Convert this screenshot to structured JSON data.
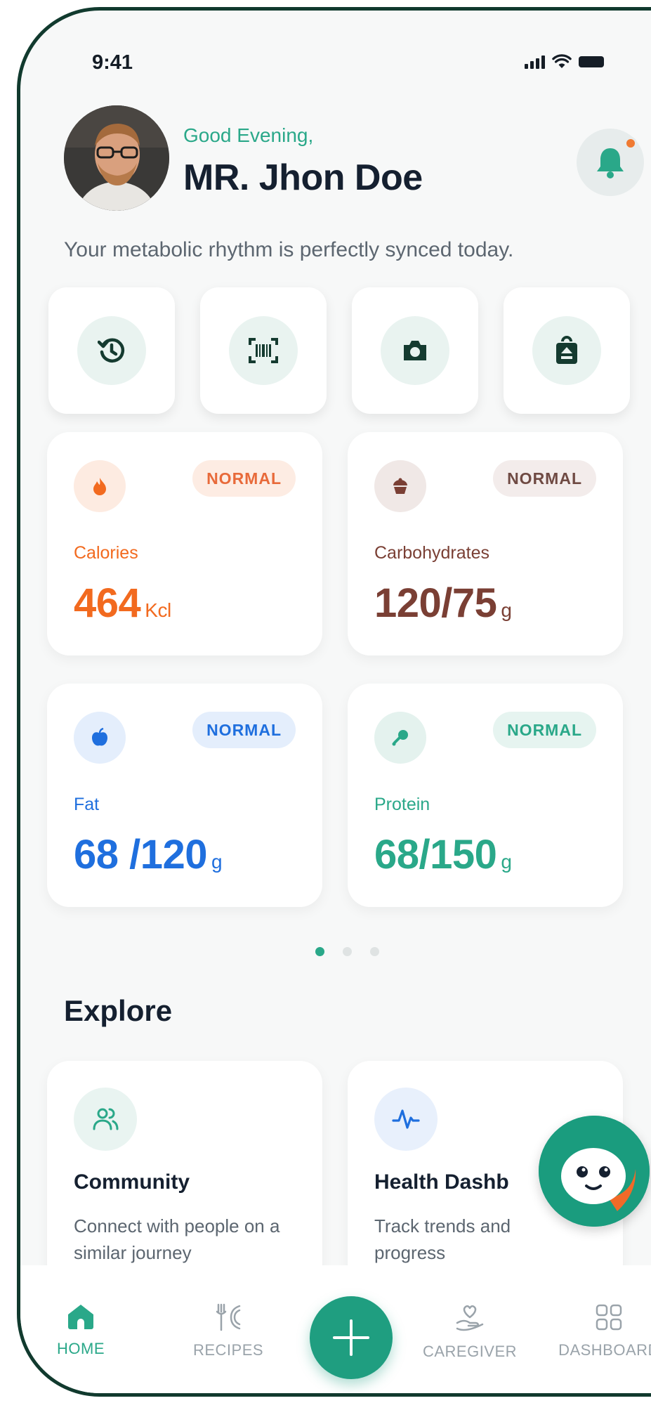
{
  "status_bar": {
    "time": "9:41"
  },
  "header": {
    "greeting": "Good Evening,",
    "name": "MR. Jhon Doe",
    "tagline": "Your metabolic rhythm is perfectly synced today."
  },
  "quick_actions": [
    {
      "icon": "history-icon"
    },
    {
      "icon": "barcode-scan-icon"
    },
    {
      "icon": "camera-icon"
    },
    {
      "icon": "bag-upload-icon"
    }
  ],
  "metrics": [
    {
      "label": "Calories",
      "value": "464",
      "unit": "Kcl",
      "badge": "NORMAL",
      "icon": "flame-icon",
      "color": "#f26a1f"
    },
    {
      "label": "Carbohydrates",
      "value": "120/75",
      "unit": "g",
      "badge": "NORMAL",
      "icon": "cupcake-icon",
      "color": "#7a3f34"
    },
    {
      "label": "Fat",
      "value": "68 /120",
      "unit": "g",
      "badge": "NORMAL",
      "icon": "apple-icon",
      "color": "#1f6fde"
    },
    {
      "label": "Protein",
      "value": "68/150",
      "unit": "g",
      "badge": "NORMAL",
      "icon": "drumstick-icon",
      "color": "#2aa889"
    }
  ],
  "pager": {
    "count": 3,
    "active": 1
  },
  "explore": {
    "title": "Explore",
    "cards": [
      {
        "title": "Community",
        "description": "Connect with people on a similar journey",
        "icon": "community-icon"
      },
      {
        "title": "Health Dashb",
        "description": "Track trends and progress",
        "icon": "pulse-icon"
      }
    ]
  },
  "nav": {
    "items": [
      {
        "label": "HOME",
        "icon": "home-icon",
        "active": true
      },
      {
        "label": "RECIPES",
        "icon": "fork-knife-icon",
        "active": false
      },
      {
        "label": "CAREGIVER",
        "icon": "heart-hand-icon",
        "active": false
      },
      {
        "label": "DASHBOARD",
        "icon": "grid-icon",
        "active": false
      }
    ],
    "fab_icon": "plus-icon"
  },
  "colors": {
    "accent": "#2aa889",
    "frame": "#113a2e",
    "notification": "#f07a32"
  }
}
